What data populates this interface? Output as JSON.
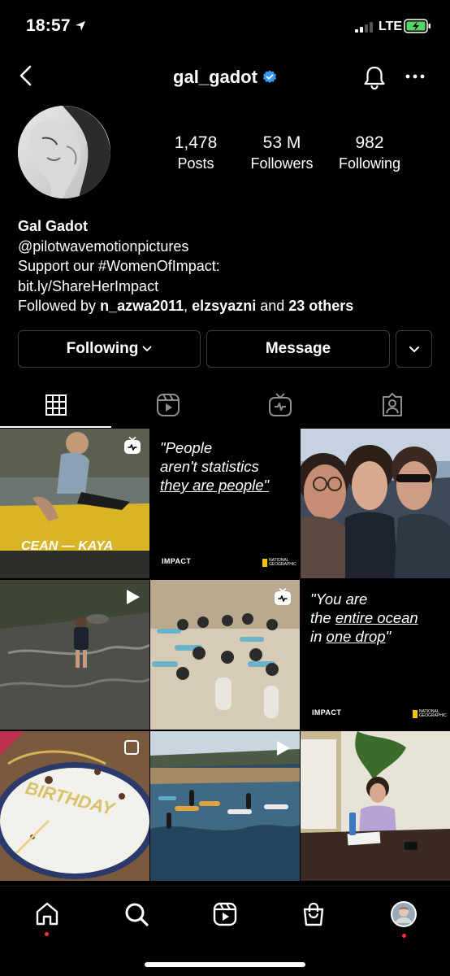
{
  "status_bar": {
    "time": "18:57",
    "network": "LTE"
  },
  "header": {
    "username": "gal_gadot",
    "icons": [
      "back-icon",
      "verified-icon",
      "bell-icon",
      "more-icon"
    ]
  },
  "profile": {
    "stats": [
      {
        "value": "1,478",
        "label": "Posts"
      },
      {
        "value": "53 M",
        "label": "Followers"
      },
      {
        "value": "982",
        "label": "Following"
      }
    ],
    "name": "Gal Gadot",
    "bio_line1": "@pilotwavemotionpictures",
    "bio_line2": "Support our #WomenOfImpact:",
    "bio_link": "bit.ly/ShareHerImpact",
    "followed_by_prefix": "Followed by ",
    "followed_by_user1": "n_azwa2011",
    "followed_by_sep": ", ",
    "followed_by_user2": "elzsyazni",
    "followed_by_and": " and ",
    "followed_by_others": "23 others"
  },
  "buttons": {
    "following": "Following",
    "message": "Message"
  },
  "tabs": [
    "grid-icon",
    "reels-icon",
    "igtv-icon",
    "tagged-icon"
  ],
  "grid": {
    "quote1_line1": "\"People",
    "quote1_line2": "aren't statistics",
    "quote1_line3": "they are people\"",
    "quote2_line1": "\"You are",
    "quote2_line2_pre": "the ",
    "quote2_line2_u": "entire ocean",
    "quote2_line3_pre": "in ",
    "quote2_line3_u": "one drop",
    "quote2_line3_post": "\"",
    "impact_label": "IMPACT",
    "natgeo_label": "NATIONAL GEOGRAPHIC",
    "kayak_text": "CEAN — KAYA",
    "cake_text": "BIRTHDAY"
  },
  "bottom_nav": [
    "home-icon",
    "search-icon",
    "reels-icon",
    "shop-icon",
    "profile-avatar"
  ],
  "colors": {
    "background": "#000000",
    "verified": "#3897f0",
    "notification_dot": "#ff3040",
    "border": "#3d3d3d"
  }
}
